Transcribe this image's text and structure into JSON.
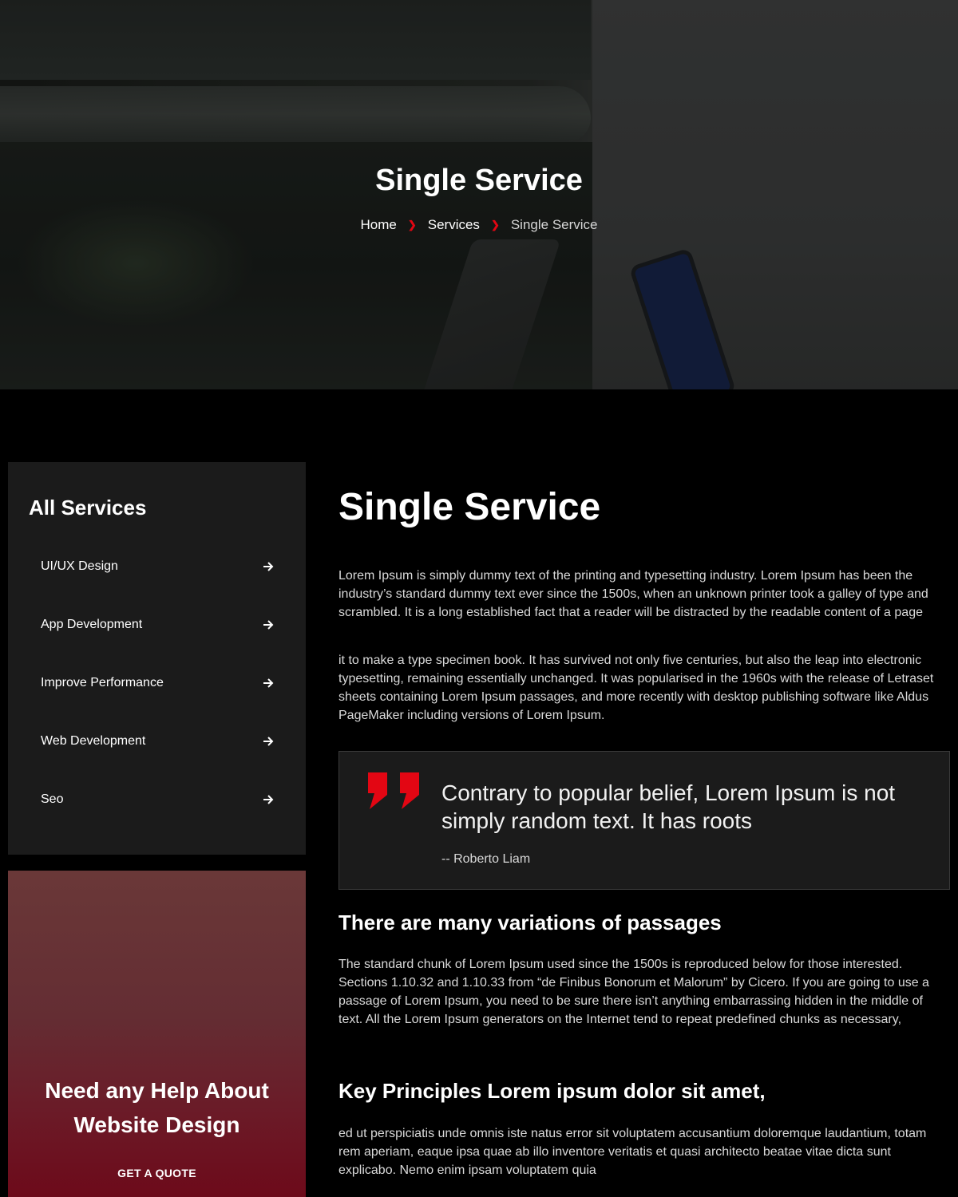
{
  "hero": {
    "title": "Single Service",
    "breadcrumb": {
      "home": "Home",
      "services": "Services",
      "current": "Single Service"
    }
  },
  "sidebar": {
    "services_title": "All Services",
    "items": [
      {
        "label": "UI/UX Design"
      },
      {
        "label": "App Development"
      },
      {
        "label": "Improve Performance"
      },
      {
        "label": "Web Development"
      },
      {
        "label": "Seo"
      }
    ],
    "help": {
      "line1": "Need any Help About",
      "line2": "Website Design",
      "button": "GET A QUOTE"
    }
  },
  "main": {
    "title": "Single Service",
    "paragraph1": "Lorem Ipsum is simply dummy text of the printing and typesetting industry. Lorem Ipsum has been the industry’s standard dummy text ever since the 1500s, when an unknown printer took a galley of type and scrambled. It is a long established fact that a reader will be distracted by the readable content of a page",
    "paragraph2": "it to make a type specimen book. It has survived not only five centuries, but also the leap into electronic typesetting, remaining essentially unchanged. It was popularised in the 1960s with the release of Letraset sheets containing Lorem Ipsum passages, and more recently with desktop publishing software like Aldus PageMaker including versions of Lorem Ipsum.",
    "quote": {
      "text": "Contrary to popular belief, Lorem Ipsum is not simply random text. It has roots",
      "author": "-- Roberto Liam"
    },
    "heading2": "There are many variations of passages",
    "paragraph3": "The standard chunk of Lorem Ipsum used since the 1500s is reproduced below for those interested. Sections 1.10.32 and 1.10.33 from “de Finibus Bonorum et Malorum” by Cicero. If you are going to use a passage of Lorem Ipsum, you need to be sure there isn’t anything embarrassing hidden in the middle of text. All the Lorem Ipsum generators on the Internet tend to repeat predefined chunks as necessary,",
    "heading3": "Key Principles Lorem ipsum dolor sit amet,",
    "paragraph4": "ed ut perspiciatis unde omnis iste natus error sit voluptatem accusantium doloremque laudantium, totam rem aperiam, eaque ipsa quae ab illo inventore veritatis et quasi architecto beatae vitae dicta sunt explicabo. Nemo enim ipsam voluptatem quia"
  },
  "colors": {
    "accent": "#e30613",
    "panel": "#1b1b1b",
    "background": "#000000"
  },
  "icons": {
    "breadcrumb_separator": "chevron-right-icon",
    "service_arrow": "arrow-right-icon",
    "quote": "quote-icon"
  }
}
